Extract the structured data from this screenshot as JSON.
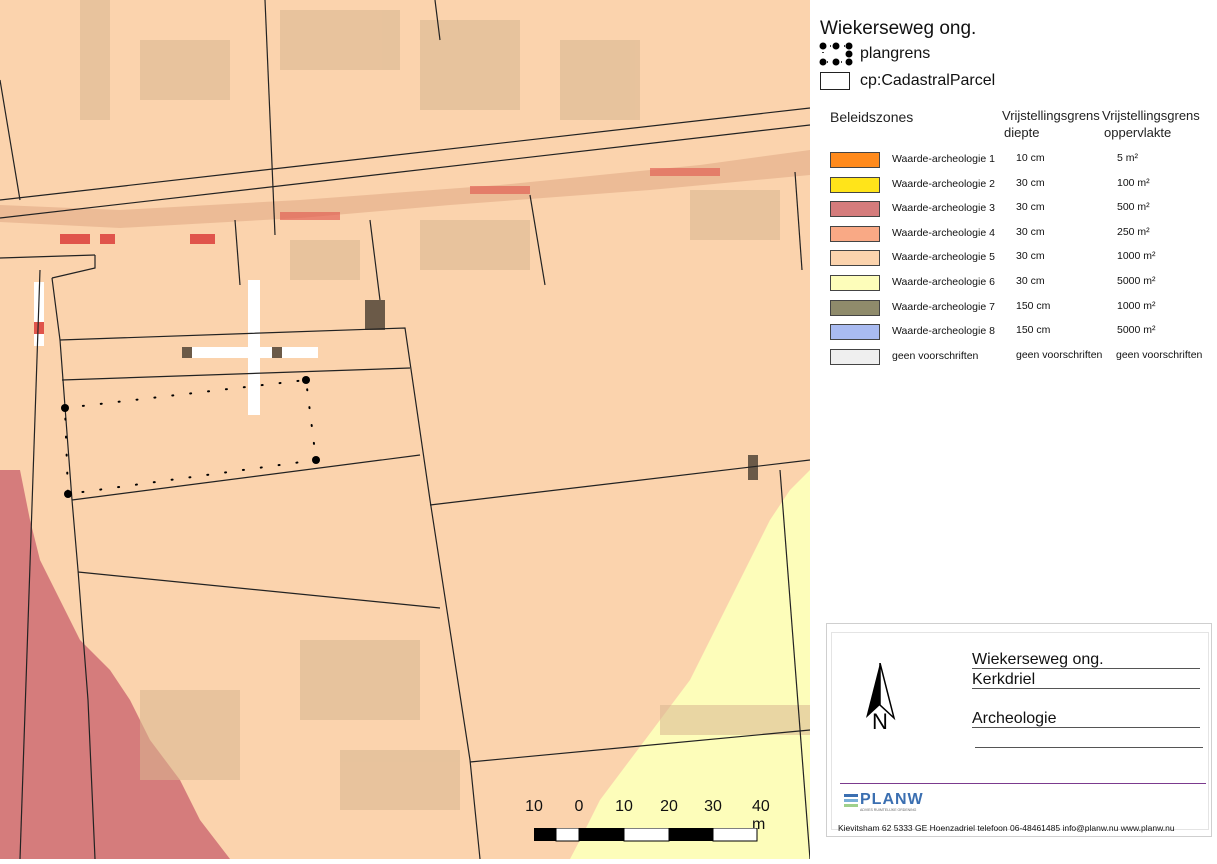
{
  "legend": {
    "title": "Wiekerseweg ong.",
    "items": [
      {
        "label": "plangrens",
        "icon": "dotted-boundary-icon"
      },
      {
        "label": "cp:CadastralParcel",
        "icon": "parcel-outline-icon"
      }
    ]
  },
  "zones_table": {
    "col_zone": "Beleidszones",
    "col_depth": [
      "Vrijstellingsgrens",
      "diepte"
    ],
    "col_area": [
      "Vrijstellingsgrens",
      "oppervlakte"
    ],
    "rows": [
      {
        "name": "Waarde-archeologie 1",
        "depth": "10 cm",
        "area": "5 m²",
        "color": "#ff8a1c"
      },
      {
        "name": "Waarde-archeologie 2",
        "depth": "30 cm",
        "area": "100 m²",
        "color": "#ffe41a"
      },
      {
        "name": "Waarde-archeologie 3",
        "depth": "30 cm",
        "area": "500 m²",
        "color": "#d57c7c"
      },
      {
        "name": "Waarde-archeologie 4",
        "depth": "30 cm",
        "area": "250 m²",
        "color": "#f9a985"
      },
      {
        "name": "Waarde-archeologie 5",
        "depth": "30 cm",
        "area": "1000 m²",
        "color": "#fbd3ad"
      },
      {
        "name": "Waarde-archeologie 6",
        "depth": "30 cm",
        "area": "5000 m²",
        "color": "#fdfdba"
      },
      {
        "name": "Waarde-archeologie 7",
        "depth": "150 cm",
        "area": "1000 m²",
        "color": "#8f8b6b"
      },
      {
        "name": "Waarde-archeologie 8",
        "depth": "150 cm",
        "area": "5000 m²",
        "color": "#a9bbf1"
      },
      {
        "name": "geen voorschriften",
        "depth": "geen voorschriften",
        "area": "geen voorschriften",
        "color": "#efefef"
      }
    ]
  },
  "title_block": {
    "line1": "Wiekerseweg ong.",
    "line2": "Kerkdriel",
    "line3": "Archeologie",
    "north_label": "N",
    "logo": "PLANW",
    "logo_tagline": "ADVIES RUIMTELIJKE ORDENING",
    "address": "Kievitsham 62 5333 GE Hoenzadriel telefoon 06-48461485 info@planw.nu www.planw.nu"
  },
  "scale_bar": {
    "labels": [
      "10",
      "0",
      "10",
      "20",
      "30",
      "40 m"
    ]
  },
  "colors": {
    "background_zone": "#fbd3ad",
    "parcel_line": "#222222",
    "boundary_dots": "#000000"
  }
}
